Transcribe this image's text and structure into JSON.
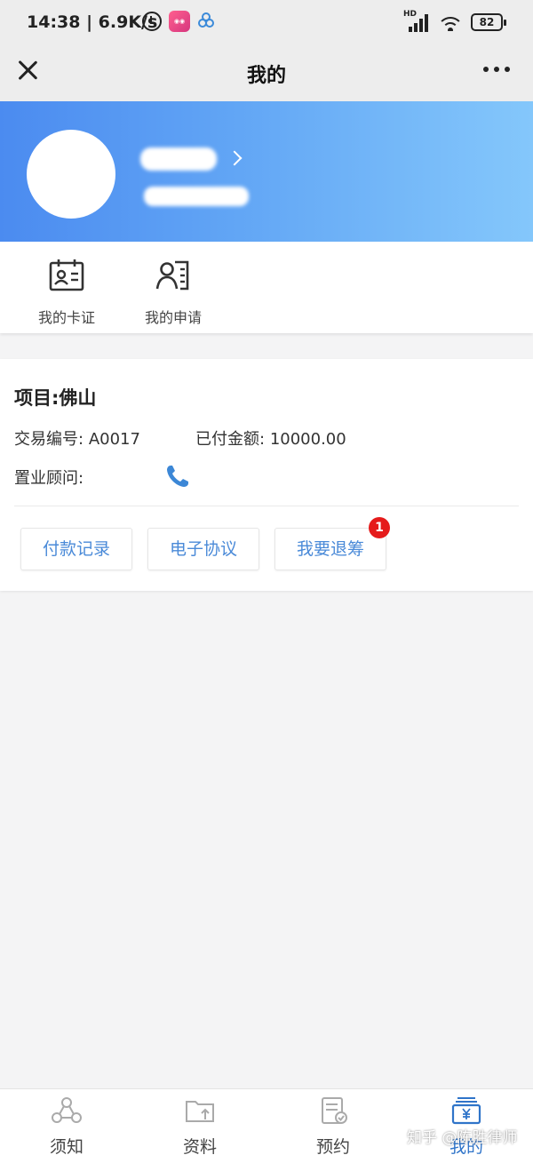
{
  "status_bar": {
    "time": "14:38",
    "network_speed": "6.9K/s",
    "signal_label": "HD",
    "battery": "82"
  },
  "header": {
    "title": "我的"
  },
  "quick_actions": [
    {
      "label": "我的卡证",
      "icon": "id-card-icon"
    },
    {
      "label": "我的申请",
      "icon": "person-list-icon"
    }
  ],
  "project": {
    "title": "项目:佛山",
    "trade_no_label": "交易编号:",
    "trade_no": "A0017",
    "paid_label": "已付金额:",
    "paid_amount": "10000.00",
    "advisor_label": "置业顾问:"
  },
  "actions": [
    {
      "label": "付款记录"
    },
    {
      "label": "电子协议"
    },
    {
      "label": "我要退筹",
      "badge": "1"
    }
  ],
  "tabs": [
    {
      "label": "须知",
      "icon": "network-icon",
      "active": false
    },
    {
      "label": "资料",
      "icon": "folder-upload-icon",
      "active": false
    },
    {
      "label": "预约",
      "icon": "document-check-icon",
      "active": false
    },
    {
      "label": "我的",
      "icon": "wallet-icon",
      "active": true
    }
  ],
  "watermark": "知乎 @陈胜律师",
  "colors": {
    "accent": "#2f74c9",
    "button_text": "#4a8ad8",
    "banner_start": "#4b8bf0",
    "banner_end": "#84c7fb",
    "badge": "#e51b1b"
  }
}
